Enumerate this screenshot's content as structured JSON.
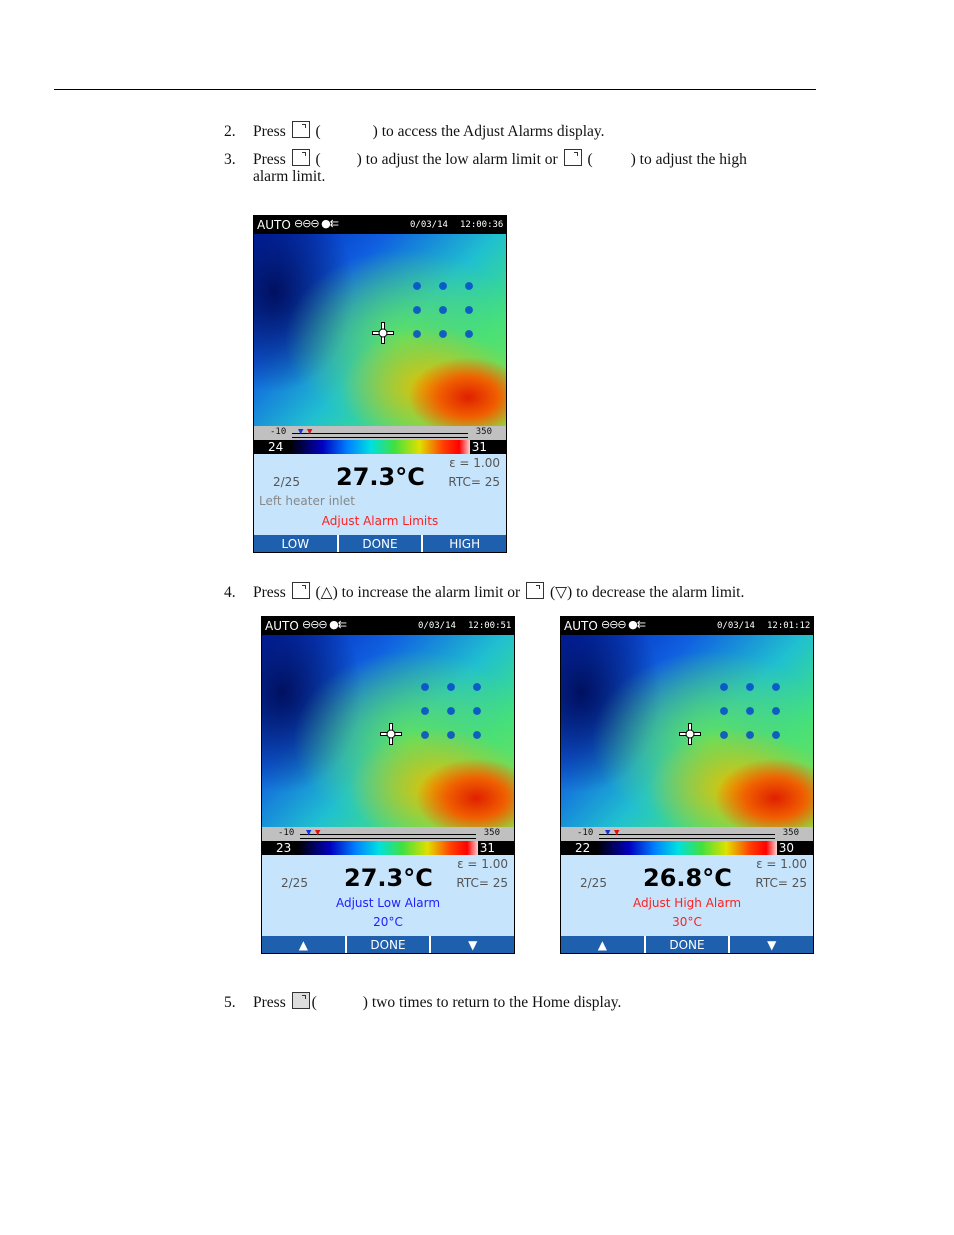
{
  "steps": [
    {
      "num": "2.",
      "parts": [
        "Press",
        "(",
        ") to access the Adjust Alarms display."
      ]
    },
    {
      "num": "3.",
      "parts": [
        "Press",
        "(",
        ") to adjust the low alarm limit or",
        "(",
        ") to adjust the high"
      ],
      "line2": "alarm limit."
    },
    {
      "num": "4.",
      "parts": [
        "Press",
        "(△) to increase the alarm limit or",
        "(▽) to decrease the alarm limit."
      ]
    },
    {
      "num": "5.",
      "parts": [
        "Press",
        "(",
        ") two times to return to the Home display."
      ]
    }
  ],
  "screens": [
    {
      "mode": "AUTO",
      "icons": "⊖⊖⊖ ●⇇",
      "date": "0/03/14",
      "time": "12:00:36",
      "range_low": "-10",
      "range_high": "350",
      "span_low": "24",
      "span_high": "31",
      "emissivity": "ε = 1.00",
      "page": "2/25",
      "temperature": "27.3°C",
      "rtc": "RTC=    25",
      "note": "Left heater inlet",
      "message": "Adjust Alarm Limits",
      "message_color": "#ff2020",
      "buttons": [
        "LOW",
        "DONE",
        "HIGH"
      ]
    },
    {
      "mode": "AUTO",
      "icons": "⊖⊖⊖ ●⇇",
      "date": "0/03/14",
      "time": "12:00:51",
      "range_low": "-10",
      "range_high": "350",
      "span_low": "23",
      "span_high": "31",
      "emissivity": "ε = 1.00",
      "page": "2/25",
      "temperature": "27.3°C",
      "rtc": "RTC=    25",
      "message": "Adjust Low Alarm",
      "value": "20°C",
      "message_color": "#2020ff",
      "buttons": [
        "▲",
        "DONE",
        "▼"
      ]
    },
    {
      "mode": "AUTO",
      "icons": "⊖⊖⊖ ●⇇",
      "date": "0/03/14",
      "time": "12:01:12",
      "range_low": "-10",
      "range_high": "350",
      "span_low": "22",
      "span_high": "30",
      "emissivity": "ε = 1.00",
      "page": "2/25",
      "temperature": "26.8°C",
      "rtc": "RTC=    25",
      "message": "Adjust High Alarm",
      "value": "30°C",
      "message_color": "#ff2020",
      "buttons": [
        "▲",
        "DONE",
        "▼"
      ]
    }
  ]
}
